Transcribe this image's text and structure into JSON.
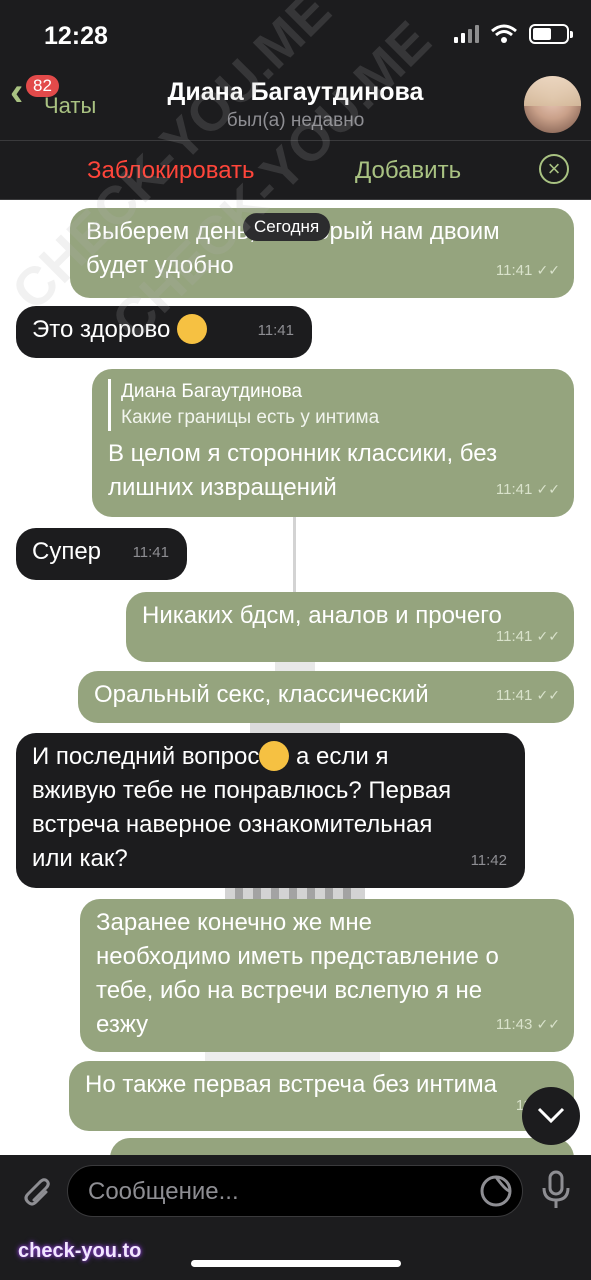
{
  "status_bar": {
    "time": "12:28"
  },
  "header": {
    "back_label": "Чаты",
    "unread_badge": "82",
    "contact_name": "Диана Багаутдинова",
    "contact_status": "был(а) недавно"
  },
  "action_bar": {
    "block_label": "Заблокировать",
    "add_label": "Добавить"
  },
  "date_chip": "Сегодня",
  "messages": [
    {
      "dir": "out",
      "text1": "Выберем день, в который нам двоим",
      "text2": "будет удобно",
      "time": "11:41"
    },
    {
      "dir": "in",
      "text": "Это здорово",
      "emoji": "relieved-face",
      "time": "11:41"
    },
    {
      "dir": "out",
      "reply_name": "Диана Багаутдинова",
      "reply_text": "Какие границы есть у интима",
      "text1": "В целом я сторонник классики, без",
      "text2": "лишних извращений",
      "time": "11:41"
    },
    {
      "dir": "in",
      "text": "Супер",
      "time": "11:41"
    },
    {
      "dir": "out",
      "text": "Никаких бдсм, аналов и прочего",
      "time": "11:41"
    },
    {
      "dir": "out",
      "text": "Оральный секс, классический",
      "time": "11:41"
    },
    {
      "dir": "in",
      "text1a": "И последний вопрос",
      "emoji": "sweat-smile-face",
      "text1b": " а если я",
      "text2": "вживую тебе не понравлюсь? Первая",
      "text3": "встреча наверное ознакомительная",
      "text4": "или как?",
      "time": "11:42"
    },
    {
      "dir": "out",
      "text1": "Заранее конечно же мне",
      "text2": "необходимо иметь представление о",
      "text3": "тебе, ибо на встречи вслепую я не",
      "text4": "езжу",
      "time": "11:43"
    },
    {
      "dir": "out",
      "text": "Но также первая встреча без интима",
      "time": "11:4"
    }
  ],
  "composer": {
    "placeholder": "Сообщение..."
  },
  "watermarks": {
    "bottom": "check-you.to",
    "diagonal": "CHECK-YOU.ME"
  },
  "colors": {
    "outgoing": "#95a47e",
    "incoming": "#1c1c1e",
    "accent": "#a9c282",
    "danger": "#ff453a"
  }
}
